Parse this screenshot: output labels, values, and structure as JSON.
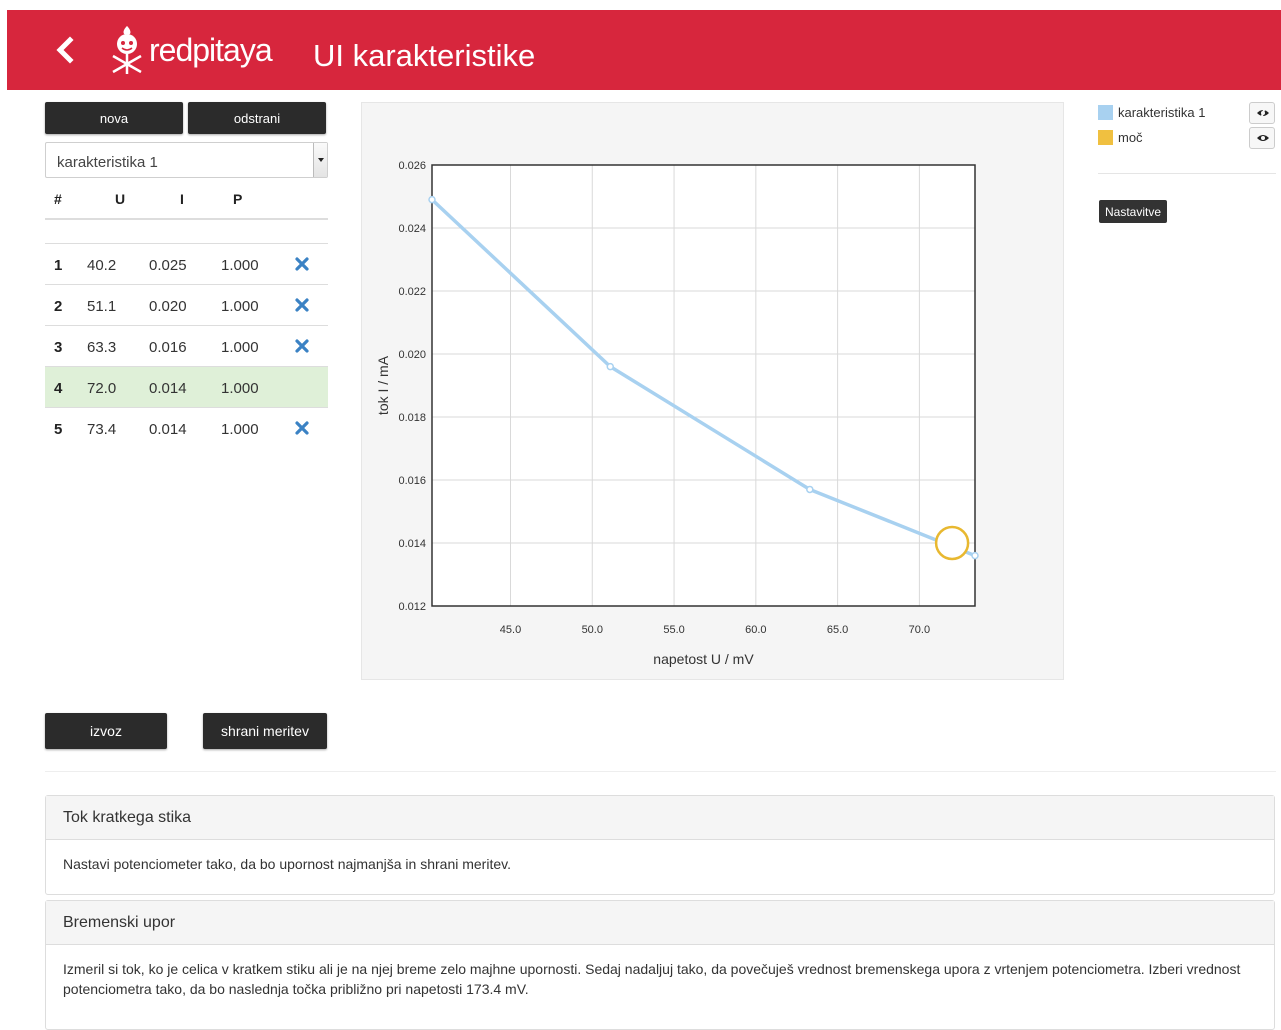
{
  "header": {
    "logo_text": "redpitaya",
    "title": "UI karakteristike",
    "bar_color": "#d7263d"
  },
  "toolbar": {
    "new_label": "nova",
    "remove_label": "odstrani",
    "export_label": "izvoz",
    "save_label": "shrani meritev"
  },
  "selector": {
    "value": "karakteristika 1"
  },
  "table": {
    "headers": [
      "#",
      "U",
      "I",
      "P"
    ],
    "rows": [
      {
        "n": "1",
        "u": "40.2",
        "i": "0.025",
        "p": "1.000",
        "deletable": true,
        "active": false
      },
      {
        "n": "2",
        "u": "51.1",
        "i": "0.020",
        "p": "1.000",
        "deletable": true,
        "active": false
      },
      {
        "n": "3",
        "u": "63.3",
        "i": "0.016",
        "p": "1.000",
        "deletable": true,
        "active": false
      },
      {
        "n": "4",
        "u": "72.0",
        "i": "0.014",
        "p": "1.000",
        "deletable": false,
        "active": true
      },
      {
        "n": "5",
        "u": "73.4",
        "i": "0.014",
        "p": "1.000",
        "deletable": true,
        "active": false
      }
    ]
  },
  "legend": {
    "items": [
      {
        "label": "karakteristika 1",
        "color": "#a8d1f0",
        "icon": "eye-slash-icon"
      },
      {
        "label": "moč",
        "color": "#f0c040",
        "icon": "eye-icon"
      }
    ],
    "settings_label": "Nastavitve"
  },
  "chart_data": {
    "type": "line",
    "xlabel": "napetost U / mV",
    "ylabel": "tok I / mA",
    "xlim": [
      40.2,
      73.4
    ],
    "ylim": [
      0.012,
      0.026
    ],
    "x_ticks": [
      "45.0",
      "50.0",
      "55.0",
      "60.0",
      "65.0",
      "70.0"
    ],
    "y_ticks": [
      "0.012",
      "0.014",
      "0.016",
      "0.018",
      "0.020",
      "0.022",
      "0.024",
      "0.026"
    ],
    "grid": true,
    "series": [
      {
        "name": "karakteristika 1",
        "color": "#a8d1f0",
        "x": [
          40.2,
          51.1,
          63.3,
          73.4
        ],
        "y": [
          0.0249,
          0.0196,
          0.0157,
          0.0136
        ]
      }
    ],
    "highlight": {
      "x": 72.0,
      "y": 0.014,
      "color": "#e8b830"
    }
  },
  "panels": [
    {
      "title": "Tok kratkega stika",
      "body": "Nastavi potenciometer tako, da bo upornost najmanjša in shrani meritev."
    },
    {
      "title": "Bremenski upor",
      "body": "Izmeril si tok, ko je celica v kratkem stiku ali je na njej breme zelo majhne upornosti. Sedaj nadaljuj tako, da povečuješ vrednost bremenskega upora z vrtenjem potenciometra. Izberi vrednost potenciometra tako, da bo naslednja točka približno pri napetosti 173.4 mV."
    }
  ]
}
